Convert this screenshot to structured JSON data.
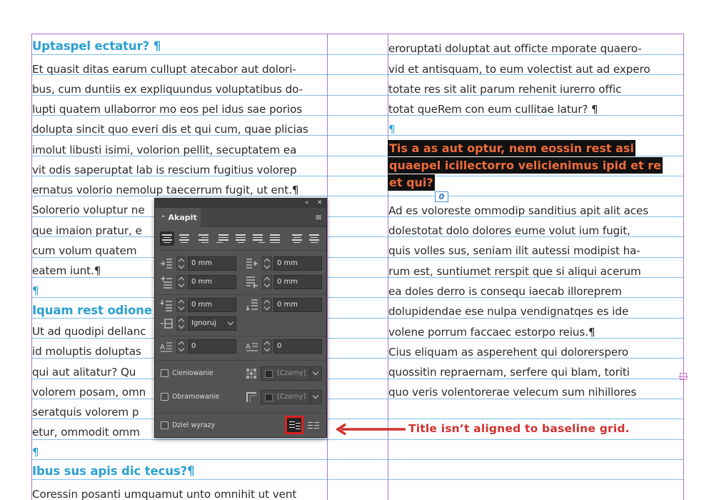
{
  "document": {
    "left_column": {
      "lines": [
        {
          "text": "Uptaspel ectatur? ¶",
          "style": "head"
        },
        {
          "text": "Et quasit ditas earum cullupt atecabor aut dolori-",
          "style": "body"
        },
        {
          "text": "bus, cum duntiis ex expliquundus voluptatibus do-",
          "style": "body"
        },
        {
          "text": "lupti quatem ullaborror mo eos pel idus sae porios",
          "style": "body"
        },
        {
          "text": "dolupta sincit quo everi dis et qui cum, quae plicias",
          "style": "body"
        },
        {
          "text": "imolut libusti isimi, volorion pellit, secuptatem ea",
          "style": "body"
        },
        {
          "text": "vit odis saperuptat lab is rescium fugitius volorep",
          "style": "body"
        },
        {
          "text": "ernatus volorio nemolup taecerrum fugit, ut ent.¶",
          "style": "body"
        },
        {
          "text": "Solorerio voluptur ne",
          "style": "body"
        },
        {
          "text": "que imaion pratur, e",
          "style": "body"
        },
        {
          "text": "cum volum quatem",
          "style": "body"
        },
        {
          "text": "eatem iunt.¶",
          "style": "body"
        },
        {
          "text": "¶",
          "style": "pil"
        },
        {
          "text": "Iquam rest odione",
          "style": "head"
        },
        {
          "text": "Ut ad quodipi dellanc",
          "style": "body"
        },
        {
          "text": "id moluptis doluptas",
          "style": "body"
        },
        {
          "text": "qui aut alitatur? Qu",
          "style": "body"
        },
        {
          "text": "volorem posam, omn",
          "style": "body"
        },
        {
          "text": "seratquis volorem p",
          "style": "body"
        },
        {
          "text": "etur, ommodit omm",
          "style": "body"
        },
        {
          "text": "¶",
          "style": "pil"
        },
        {
          "text": "Ibus sus apis dic tecus?¶",
          "style": "head"
        },
        {
          "text": "Coressin posanti umquamut unto omnihit ut vent",
          "style": "body"
        }
      ]
    },
    "right_column": {
      "top_lines": [
        "eroruptati doluptat aut officte mporate quaero-",
        "vid et antisquam, to eum volectist aut ad expero",
        "totate res sit alit parum rehenit iurerro offic",
        "totat queRem con eum cullitae latur? ¶",
        "¶"
      ],
      "highlight_lines": [
        "Tis a as aut optur, nem eossin rest asi",
        "quaepel icillectorro velicienimus ipid et re",
        "et qui?"
      ],
      "frame_marker": "0",
      "body_lines": [
        "Ad es voloreste ommodip sanditius apit alit aces",
        "dolestotat dolo dolores eume volut ium fugit,",
        "quis volles sus, seniam ilit autessi modipist ha-",
        "rum est, suntiumet rerspit que si aliqui acerum",
        "ea doles derro is consequ iaecab illoreprem",
        "dolupidendae ese nulpa vendignatqes es ide",
        "volene porrum faccaec estorpo reius.¶",
        "Cius eliquam as asperehent qui dolorerspero",
        "quossitin repraernam, serfere qui blam, toriti",
        "quo veris volentorerae velecum sum nihillores"
      ]
    }
  },
  "panel": {
    "tab_label": "Akapit",
    "collapse_glyph": "«",
    "close_glyph": "✕",
    "menu_glyph": "≡",
    "indent_left": "0 mm",
    "indent_right": "0 mm",
    "first_line_indent": "0 mm",
    "last_line_indent": "0 mm",
    "space_before": "0 mm",
    "space_after": "0 mm",
    "align_to_grid": "Ignoruj",
    "drop_cap_lines": "0",
    "drop_cap_chars": "0",
    "shading_label": "Cieniowanie",
    "shading_color": "[Czarny]",
    "border_label": "Obramowanie",
    "border_color": "[Czarny]",
    "hyphenate_label": "Dziel wyrazy"
  },
  "annotation": {
    "text": "Title isn’t aligned to baseline grid.",
    "color": "#d0312d"
  },
  "colors": {
    "heading": "#2aa0d0",
    "grid": "#7fc0ea",
    "guide": "#b070d8",
    "highlight_bg": "#111111",
    "highlight_text": "#ee6a3a",
    "panel_bg": "#535353"
  }
}
